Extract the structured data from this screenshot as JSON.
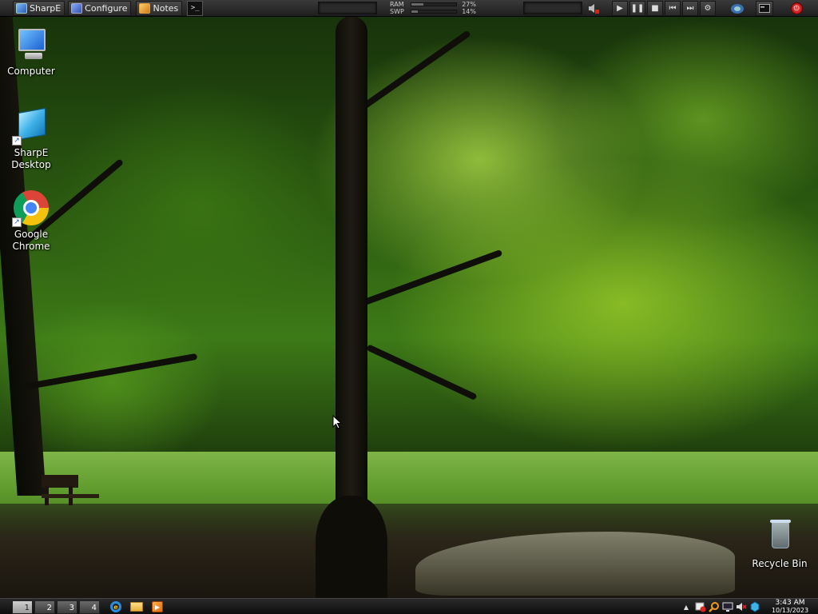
{
  "topbar": {
    "buttons": [
      {
        "label": "SharpE",
        "icon": "sharpe-icon"
      },
      {
        "label": "Configure",
        "icon": "configure-icon"
      },
      {
        "label": "Notes",
        "icon": "notes-icon"
      }
    ],
    "terminal_icon": "terminal-icon",
    "memory": {
      "ram_label": "RAM",
      "ram_percent": "27%",
      "ram_fill": 0.27,
      "swp_label": "SWP",
      "swp_percent": "14%",
      "swp_fill": 0.14
    },
    "media_controls": [
      "volume-muted-icon",
      "play-icon",
      "pause-icon",
      "stop-icon",
      "previous-icon",
      "next-icon",
      "media-settings-icon"
    ],
    "system_icons": [
      "network-icon",
      "console-icon",
      "power-icon"
    ]
  },
  "desktop": {
    "icons": [
      {
        "label": "Computer"
      },
      {
        "label": "SharpE Desktop"
      },
      {
        "label": "Google Chrome"
      },
      {
        "label": "Recycle Bin"
      }
    ]
  },
  "taskbar": {
    "workspaces": [
      "1",
      "2",
      "3",
      "4"
    ],
    "active_workspace": "1",
    "apps": [
      "internet-explorer-icon",
      "file-explorer-icon",
      "media-player-icon"
    ],
    "tray_icons": [
      "network-warning-icon",
      "search-icon",
      "display-icon",
      "speaker-muted-icon",
      "app-cube-icon"
    ],
    "clock": {
      "time": "3:43 AM",
      "date": "10/13/2023"
    }
  },
  "colors": {
    "topbar_bg": "#2a2a2a",
    "taskbar_bg": "#1a1a1a",
    "power_red": "#d01010"
  }
}
